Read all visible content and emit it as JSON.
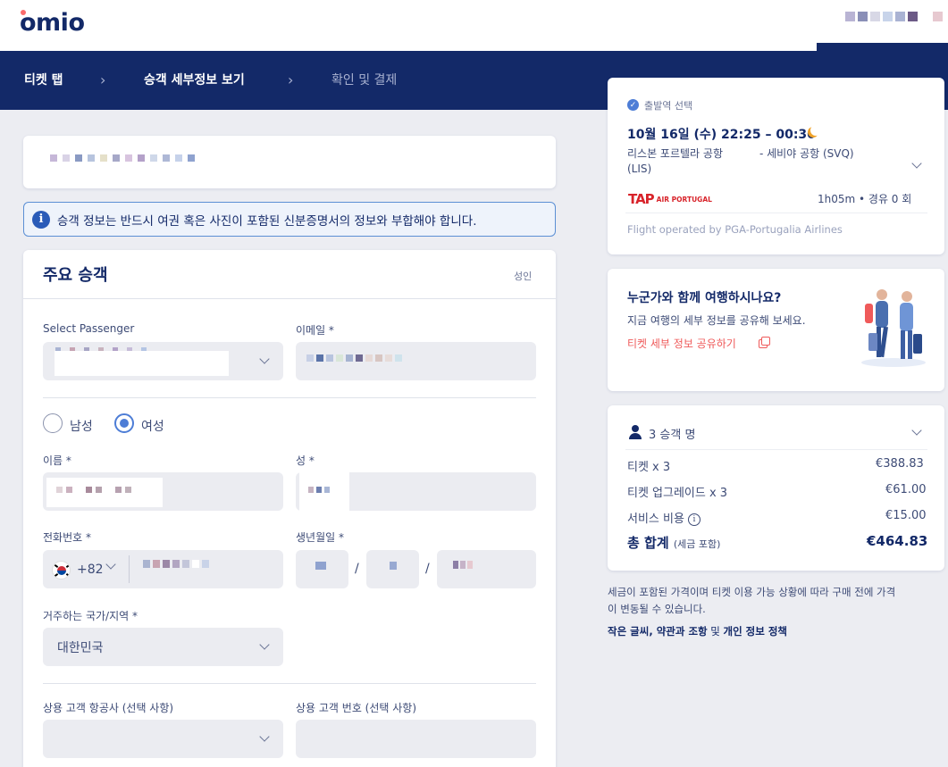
{
  "brand": {
    "logo_text": "omio"
  },
  "breadcrumb": {
    "step1": "티켓 탭",
    "step2": "승객 세부정보 보기",
    "step3": "확인 및 결제"
  },
  "info_banner": {
    "text": "승객 정보는 반드시 여권 혹은 사진이 포함된 신분증명서의 정보와 부합해야 합니다."
  },
  "passenger": {
    "section_title": "주요 승객",
    "adult_tag": "성인",
    "select_passenger_label": "Select Passenger",
    "email_label": "이메일 *",
    "gender_male": "남성",
    "gender_female": "여성",
    "first_name_label": "이름 *",
    "last_name_label": "성 *",
    "phone_label": "전화번호 *",
    "country_code": "+82",
    "birth_label": "생년월일 *",
    "date_separator": "/",
    "country_label": "거주하는 국가/지역 *",
    "country_value": "대한민국",
    "ff_airline_label": "상용 고객 항공사 (선택 사항)",
    "ff_number_label": "상용 고객 번호 (선택 사항)"
  },
  "trip": {
    "badge": "출발역 선택",
    "date_time": "10월 16일 (수)   22:25 – 00:30",
    "from": "리스본 포르텔라 공항",
    "from_code": "(LIS)",
    "to": "-  세비야 공항 (SVQ)",
    "airline_logo": "TAP",
    "airline_logo_sub": "AIR PORTUGAL",
    "duration": "1h05m • 경유 0 회",
    "operated_by": "Flight operated by PGA-Portugalia Airlines"
  },
  "share": {
    "title": "누군가와 함께 여행하시나요?",
    "subtitle": "지금 여행의 세부 정보를 공유해 보세요.",
    "link": "티켓 세부 정보 공유하기"
  },
  "price": {
    "passengers": "3 승객 명",
    "rows": [
      {
        "label": "티켓 x 3",
        "value": "€388.83"
      },
      {
        "label": "티켓 업그레이드 x 3",
        "value": "€61.00"
      },
      {
        "label": "서비스 비용",
        "value": "€15.00"
      }
    ],
    "total_label": "총 합계",
    "total_note": "(세금 포함)",
    "total_value": "€464.83"
  },
  "footer_note": {
    "line1": "세금이 포함된 가격이며 티켓 이용 가능 상황에 따라 구매 전에 가격",
    "line2": "이 변동될 수 있습니다.",
    "policy_a": "작은 글씨, 약관과 조항",
    "policy_and": " 및 ",
    "policy_b": "개인 정보 정책"
  },
  "colors": {
    "navy": "#132968",
    "accent_blue": "#4d7dd6",
    "coral": "#ef5a5a",
    "tap_red": "#d8232a"
  }
}
